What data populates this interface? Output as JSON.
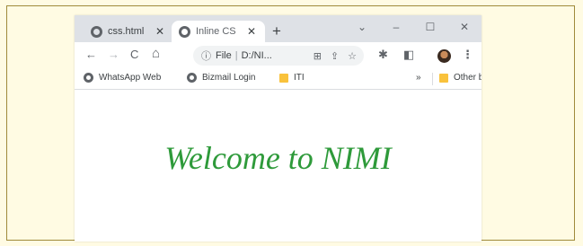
{
  "tabs": [
    {
      "title": "css.html",
      "active": false,
      "close": "✕"
    },
    {
      "title": "Inline CS",
      "active": true,
      "close": "✕"
    }
  ],
  "new_tab": "+",
  "window_controls": {
    "dropdown": "⌄",
    "minimize": "–",
    "maximize": "☐",
    "close": "✕"
  },
  "toolbar": {
    "back": "←",
    "forward": "→",
    "reload": "C",
    "home": "⌂",
    "info_icon": "ⓘ",
    "scheme": "File",
    "address": "D:/NI...",
    "menu": "⋮"
  },
  "bookmarks": {
    "items": [
      {
        "label": "WhatsApp Web",
        "icon": "globe-icon"
      },
      {
        "label": "Bizmail Login",
        "icon": "globe-icon"
      },
      {
        "label": "ITI",
        "icon": "folder-icon"
      }
    ],
    "overflow": "»",
    "other": "Other bookmarks"
  },
  "page": {
    "heading": "Welcome to NIMI",
    "heading_color": "#2e9a3a"
  },
  "colors": {
    "tabstrip": "#dee1e6",
    "page_background": "#fffbe3"
  }
}
